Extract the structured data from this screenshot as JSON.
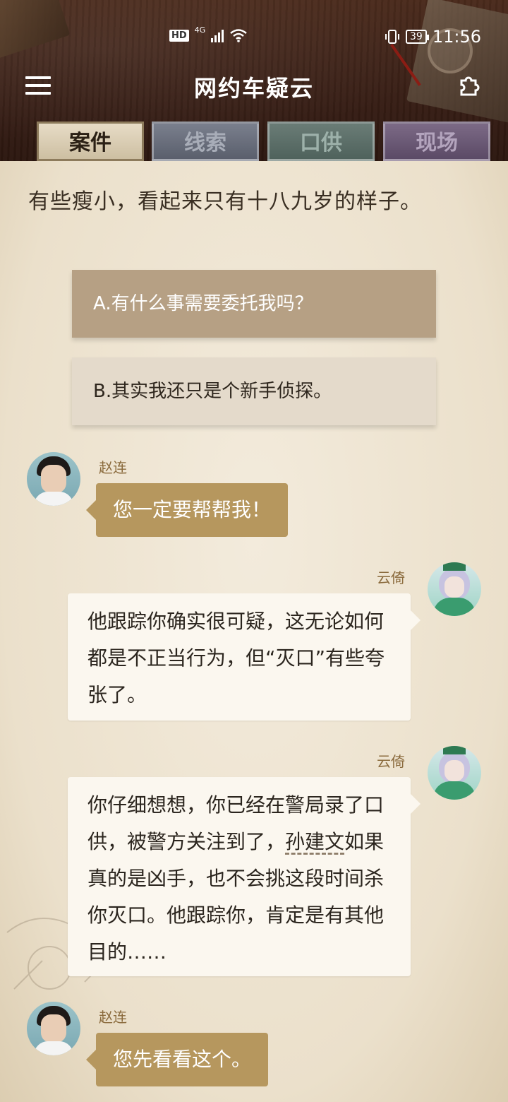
{
  "status_bar": {
    "hd": "HD",
    "network": "4G",
    "battery": "39",
    "time": "11:56"
  },
  "app": {
    "title": "网约车疑云"
  },
  "tabs": [
    {
      "label": "案件"
    },
    {
      "label": "线索"
    },
    {
      "label": "口供"
    },
    {
      "label": "现场"
    }
  ],
  "intro_text": "有些瘦小，看起来只有十八九岁的样子。",
  "choices": [
    {
      "label": "A.有什么事需要委托我吗？"
    },
    {
      "label": "B.其实我还只是个新手侦探。"
    }
  ],
  "messages": [
    {
      "speaker": "赵连",
      "text": "您一定要帮帮我！"
    },
    {
      "speaker": "云倚",
      "text": "他跟踪你确实很可疑，这无论如何都是不正当行为，但“灭口”有些夸张了。"
    },
    {
      "speaker": "云倚",
      "text_before": "你仔细想想，你已经在警局录了口供，被警方关注到了，",
      "link": "孙建文",
      "text_after": "如果真的是凶手，也不会挑这段时间杀你灭口。他跟踪你，肯定是有其他目的……"
    },
    {
      "speaker": "赵连",
      "text": "您先看看这个。"
    }
  ],
  "icons": {
    "menu": "menu-icon",
    "settings": "puzzle-settings-icon",
    "wifi": "wifi-icon",
    "vibrate": "vibrate-icon"
  }
}
